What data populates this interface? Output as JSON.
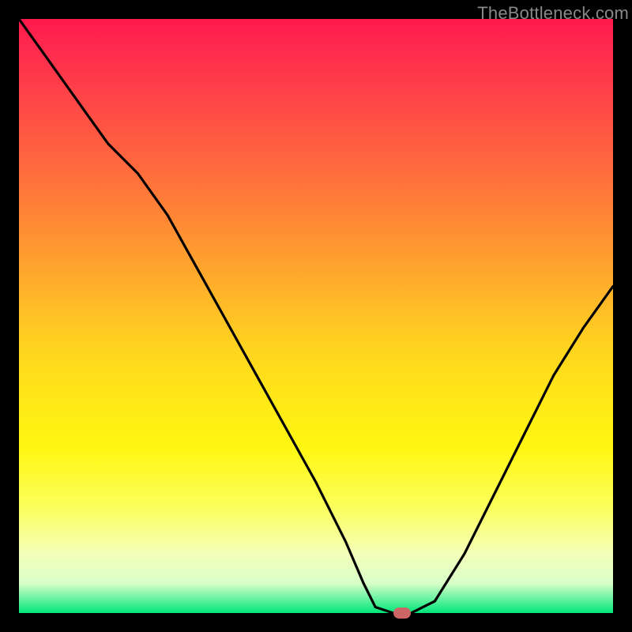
{
  "watermark": "TheBottleneck.com",
  "chart_data": {
    "type": "line",
    "title": "",
    "xlabel": "",
    "ylabel": "",
    "xlim": [
      0,
      100
    ],
    "ylim": [
      0,
      100
    ],
    "x": [
      0,
      5,
      10,
      15,
      20,
      25,
      30,
      35,
      40,
      45,
      50,
      55,
      58,
      60,
      63,
      66,
      70,
      75,
      80,
      85,
      90,
      95,
      100
    ],
    "values": [
      100,
      93,
      86,
      79,
      74,
      67,
      58,
      49,
      40,
      31,
      22,
      12,
      5,
      1,
      0,
      0,
      2,
      10,
      20,
      30,
      40,
      48,
      55
    ],
    "marker": {
      "x": 64.5,
      "y": 0
    },
    "gradient_stops": [
      {
        "pos": 0,
        "color": "#ff1a4d"
      },
      {
        "pos": 25,
        "color": "#ff6a3d"
      },
      {
        "pos": 55,
        "color": "#ffd31f"
      },
      {
        "pos": 82,
        "color": "#fbff5a"
      },
      {
        "pos": 95,
        "color": "#d8ffc9"
      },
      {
        "pos": 100,
        "color": "#00e67a"
      }
    ]
  }
}
